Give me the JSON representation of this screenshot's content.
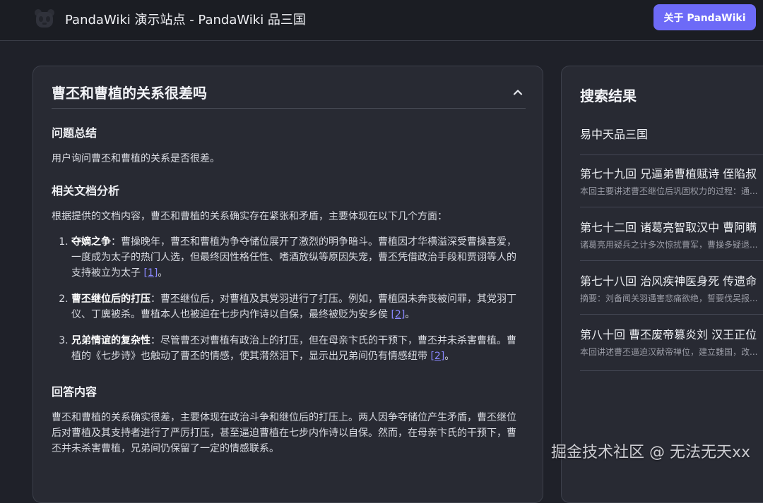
{
  "header": {
    "site_title": "PandaWiki 演示站点 - PandaWiki 品三国",
    "about_button": "关于 PandaWiki",
    "logo_icon": "panda-logo-icon"
  },
  "answer": {
    "question": "曹丕和曹植的关系很差吗",
    "toggle_icon": "chevron-up-icon",
    "summary_heading": "问题总结",
    "summary_text": "用户询问曹丕和曹植的关系是否很差。",
    "analysis_heading": "相关文档分析",
    "analysis_intro": "根据提供的文档内容，曹丕和曹植的关系确实存在紧张和矛盾，主要体现在以下几个方面：",
    "points": [
      {
        "label": "夺嫡之争",
        "text": "：曹操晚年，曹丕和曹植为争夺储位展开了激烈的明争暗斗。曹植因才华横溢深受曹操喜爱，一度成为太子的热门人选，但最终因性格任性、嗜酒放纵等原因失宠，曹丕凭借政治手段和贾诩等人的支持被立为太子 ",
        "ref": "[1]",
        "tail": "。"
      },
      {
        "label": "曹丕继位后的打压",
        "text": "：曹丕继位后，对曹植及其党羽进行了打压。例如，曹植因未奔丧被问罪，其党羽丁仪、丁廙被杀。曹植本人也被迫在七步内作诗以自保，最终被贬为安乡侯 ",
        "ref": "[2]",
        "tail": "。"
      },
      {
        "label": "兄弟情谊的复杂性",
        "text": "：尽管曹丕对曹植有政治上的打压，但在母亲卞氏的干预下，曹丕并未杀害曹植。曹植的《七步诗》也触动了曹丕的情感，使其潸然泪下，显示出兄弟间仍有情感纽带 ",
        "ref": "[2]",
        "tail": "。"
      }
    ],
    "answer_heading": "回答内容",
    "answer_text": "曹丕和曹植的关系确实很差，主要体现在政治斗争和继位后的打压上。两人因争夺储位产生矛盾，曹丕继位后对曹植及其支持者进行了严厉打压，甚至逼迫曹植在七步内作诗以自保。然而，在母亲卞氏的干预下，曹丕并未杀害曹植，兄弟间仍保留了一定的情感联系。"
  },
  "search": {
    "heading": "搜索结果",
    "results": [
      {
        "title": "易中天品三国",
        "summary": ""
      },
      {
        "title": "第七十九回 兄逼弟曹植赋诗 侄陷叔",
        "summary": "本回主要讲述曹丕继位后巩固权力的过程：通..."
      },
      {
        "title": "第七十二回 诸葛亮智取汉中 曹阿瞒",
        "summary": "诸葛亮用疑兵之计多次惊扰曹军，曹操多疑退..."
      },
      {
        "title": "第七十八回 治风疾神医身死 传遗命",
        "summary": "摘要：刘备闻关羽遇害悲痛欲绝，誓要伐吴报..."
      },
      {
        "title": "第八十回 曹丕废帝篡炎刘 汉王正位",
        "summary": "本回讲述曹丕逼迫汉献帝禅位，建立魏国，改..."
      }
    ]
  },
  "watermark": "掘金技术社区 @ 无法无天xx"
}
